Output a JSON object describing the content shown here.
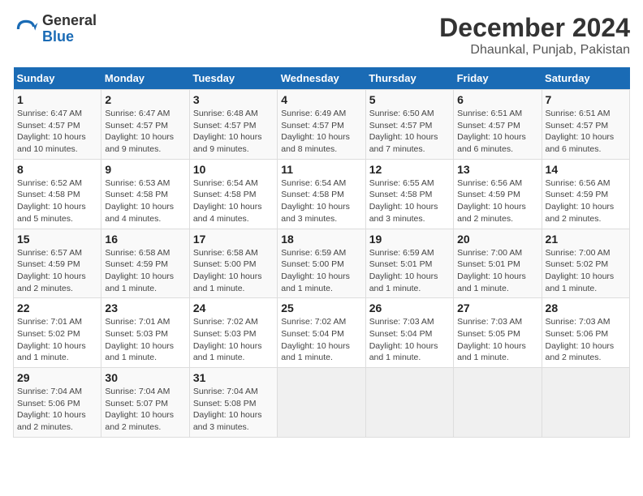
{
  "logo": {
    "text_general": "General",
    "text_blue": "Blue"
  },
  "title": "December 2024",
  "subtitle": "Dhaunkal, Punjab, Pakistan",
  "weekdays": [
    "Sunday",
    "Monday",
    "Tuesday",
    "Wednesday",
    "Thursday",
    "Friday",
    "Saturday"
  ],
  "weeks": [
    [
      {
        "day": "1",
        "sunrise": "6:47 AM",
        "sunset": "4:57 PM",
        "daylight": "10 hours and 10 minutes."
      },
      {
        "day": "2",
        "sunrise": "6:47 AM",
        "sunset": "4:57 PM",
        "daylight": "10 hours and 9 minutes."
      },
      {
        "day": "3",
        "sunrise": "6:48 AM",
        "sunset": "4:57 PM",
        "daylight": "10 hours and 9 minutes."
      },
      {
        "day": "4",
        "sunrise": "6:49 AM",
        "sunset": "4:57 PM",
        "daylight": "10 hours and 8 minutes."
      },
      {
        "day": "5",
        "sunrise": "6:50 AM",
        "sunset": "4:57 PM",
        "daylight": "10 hours and 7 minutes."
      },
      {
        "day": "6",
        "sunrise": "6:51 AM",
        "sunset": "4:57 PM",
        "daylight": "10 hours and 6 minutes."
      },
      {
        "day": "7",
        "sunrise": "6:51 AM",
        "sunset": "4:57 PM",
        "daylight": "10 hours and 6 minutes."
      }
    ],
    [
      {
        "day": "8",
        "sunrise": "6:52 AM",
        "sunset": "4:58 PM",
        "daylight": "10 hours and 5 minutes."
      },
      {
        "day": "9",
        "sunrise": "6:53 AM",
        "sunset": "4:58 PM",
        "daylight": "10 hours and 4 minutes."
      },
      {
        "day": "10",
        "sunrise": "6:54 AM",
        "sunset": "4:58 PM",
        "daylight": "10 hours and 4 minutes."
      },
      {
        "day": "11",
        "sunrise": "6:54 AM",
        "sunset": "4:58 PM",
        "daylight": "10 hours and 3 minutes."
      },
      {
        "day": "12",
        "sunrise": "6:55 AM",
        "sunset": "4:58 PM",
        "daylight": "10 hours and 3 minutes."
      },
      {
        "day": "13",
        "sunrise": "6:56 AM",
        "sunset": "4:59 PM",
        "daylight": "10 hours and 2 minutes."
      },
      {
        "day": "14",
        "sunrise": "6:56 AM",
        "sunset": "4:59 PM",
        "daylight": "10 hours and 2 minutes."
      }
    ],
    [
      {
        "day": "15",
        "sunrise": "6:57 AM",
        "sunset": "4:59 PM",
        "daylight": "10 hours and 2 minutes."
      },
      {
        "day": "16",
        "sunrise": "6:58 AM",
        "sunset": "4:59 PM",
        "daylight": "10 hours and 1 minute."
      },
      {
        "day": "17",
        "sunrise": "6:58 AM",
        "sunset": "5:00 PM",
        "daylight": "10 hours and 1 minute."
      },
      {
        "day": "18",
        "sunrise": "6:59 AM",
        "sunset": "5:00 PM",
        "daylight": "10 hours and 1 minute."
      },
      {
        "day": "19",
        "sunrise": "6:59 AM",
        "sunset": "5:01 PM",
        "daylight": "10 hours and 1 minute."
      },
      {
        "day": "20",
        "sunrise": "7:00 AM",
        "sunset": "5:01 PM",
        "daylight": "10 hours and 1 minute."
      },
      {
        "day": "21",
        "sunrise": "7:00 AM",
        "sunset": "5:02 PM",
        "daylight": "10 hours and 1 minute."
      }
    ],
    [
      {
        "day": "22",
        "sunrise": "7:01 AM",
        "sunset": "5:02 PM",
        "daylight": "10 hours and 1 minute."
      },
      {
        "day": "23",
        "sunrise": "7:01 AM",
        "sunset": "5:03 PM",
        "daylight": "10 hours and 1 minute."
      },
      {
        "day": "24",
        "sunrise": "7:02 AM",
        "sunset": "5:03 PM",
        "daylight": "10 hours and 1 minute."
      },
      {
        "day": "25",
        "sunrise": "7:02 AM",
        "sunset": "5:04 PM",
        "daylight": "10 hours and 1 minute."
      },
      {
        "day": "26",
        "sunrise": "7:03 AM",
        "sunset": "5:04 PM",
        "daylight": "10 hours and 1 minute."
      },
      {
        "day": "27",
        "sunrise": "7:03 AM",
        "sunset": "5:05 PM",
        "daylight": "10 hours and 1 minute."
      },
      {
        "day": "28",
        "sunrise": "7:03 AM",
        "sunset": "5:06 PM",
        "daylight": "10 hours and 2 minutes."
      }
    ],
    [
      {
        "day": "29",
        "sunrise": "7:04 AM",
        "sunset": "5:06 PM",
        "daylight": "10 hours and 2 minutes."
      },
      {
        "day": "30",
        "sunrise": "7:04 AM",
        "sunset": "5:07 PM",
        "daylight": "10 hours and 2 minutes."
      },
      {
        "day": "31",
        "sunrise": "7:04 AM",
        "sunset": "5:08 PM",
        "daylight": "10 hours and 3 minutes."
      },
      null,
      null,
      null,
      null
    ]
  ]
}
